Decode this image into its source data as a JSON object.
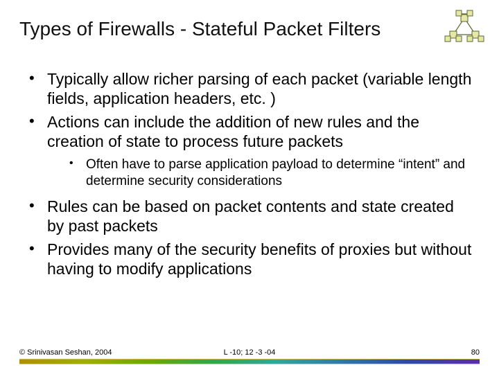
{
  "title": "Types of Firewalls - Stateful Packet Filters",
  "bullets": {
    "b0": "Typically allow richer parsing of each packet (variable length fields, application headers, etc. )",
    "b1": "Actions can include the addition of new rules and the creation of state to process future packets",
    "b1_sub0": "Often have to parse application payload to determine “intent” and determine security considerations",
    "b2": "Rules can be based on packet contents and state created by past packets",
    "b3": "Provides many of the security benefits of proxies but without having to modify applications"
  },
  "footer": {
    "left": "© Srinivasan Seshan, 2004",
    "center": "L -10; 12 -3 -04",
    "right": "80"
  }
}
